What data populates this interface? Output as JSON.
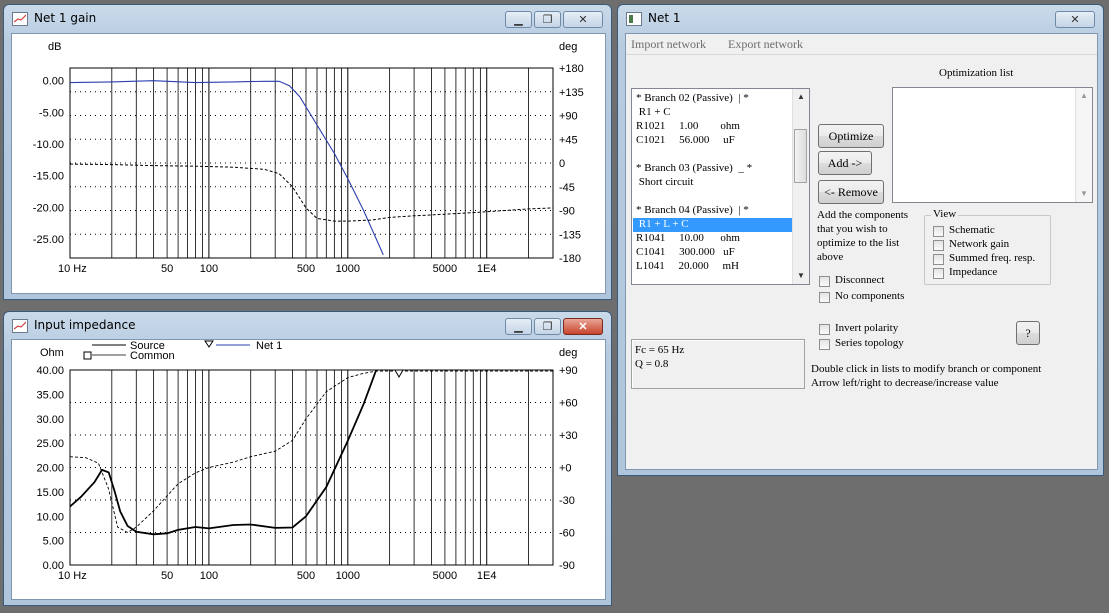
{
  "gain_window": {
    "title": "Net 1 gain",
    "y_left_unit": "dB",
    "y_right_unit": "deg",
    "y_left_ticks": [
      "0.00",
      "-5.00",
      "-10.00",
      "-15.00",
      "-20.00",
      "-25.00"
    ],
    "y_right_ticks": [
      "+180",
      "+135",
      "+90",
      "+45",
      "0",
      "-45",
      "-90",
      "-135",
      "-180"
    ],
    "x_ticks": [
      "10 Hz",
      "50",
      "100",
      "500",
      "1000",
      "5000",
      "1E4"
    ]
  },
  "impedance_window": {
    "title": "Input impedance",
    "y_left_unit": "Ohm",
    "y_right_unit": "deg",
    "legend": {
      "source": "Source",
      "common": "Common",
      "net": "Net 1"
    },
    "y_left_ticks": [
      "40.00",
      "35.00",
      "30.00",
      "25.00",
      "20.00",
      "15.00",
      "10.00",
      "5.00",
      "0.00"
    ],
    "y_right_ticks": [
      "+90",
      "+60",
      "+30",
      "+0",
      "-30",
      "-60",
      "-90"
    ],
    "x_ticks": [
      "10 Hz",
      "50",
      "100",
      "500",
      "1000",
      "5000",
      "1E4"
    ]
  },
  "net_window": {
    "title": "Net 1",
    "menu": [
      "Import network",
      "Export network"
    ],
    "branch_list": [
      "* Branch 02 (Passive)  | *",
      " R1 + C",
      "R1021     1.00        ohm",
      "C1021     56.000     uF",
      "",
      "* Branch 03 (Passive)  _ *",
      " Short circuit",
      "",
      "* Branch 04 (Passive)  | *",
      " R1 + L + C",
      "R1041     10.00      ohm",
      "C1041     300.000   uF",
      "L1041     20.000     mH"
    ],
    "selected_index": 9,
    "optimization_label": "Optimization list",
    "buttons": {
      "optimize": "Optimize",
      "add": "Add ->",
      "remove": "<- Remove",
      "help": "?"
    },
    "add_hint": [
      "Add the components",
      "that you wish to",
      "optimize to the list",
      "above"
    ],
    "checkboxes": [
      "Disconnect",
      "No components",
      "Invert polarity",
      "Series topology"
    ],
    "view_group": {
      "label": "View",
      "items": [
        "Schematic",
        "Network gain",
        "Summed freq. resp.",
        "Impedance"
      ]
    },
    "fc_text": "Fc = 65 Hz",
    "q_text": "Q = 0.8",
    "hints": [
      "Double click in lists to modify branch or component",
      "Arrow left/right to decrease/increase value"
    ]
  },
  "chart_data": [
    {
      "type": "line",
      "title": "Net 1 gain",
      "xlabel": "",
      "ylabel": "dB",
      "y2label": "deg",
      "xscale": "log",
      "xlim": [
        10,
        30000
      ],
      "ylim": [
        -28,
        2
      ],
      "y2lim": [
        -180,
        180
      ],
      "series": [
        {
          "name": "",
          "axis": "left",
          "x": [
            10,
            20,
            40,
            80,
            150,
            250,
            320,
            380,
            450,
            600,
            800,
            1000,
            1300,
            1800
          ],
          "y": [
            -0.3,
            -0.2,
            0.0,
            -0.3,
            -0.2,
            -0.1,
            -0.1,
            -0.8,
            -2.5,
            -7.0,
            -11.5,
            -15.5,
            -20.5,
            -27.5
          ]
        },
        {
          "name": "",
          "axis": "right",
          "x": [
            10,
            20,
            40,
            80,
            150,
            250,
            320,
            400,
            500,
            600,
            800,
            1000,
            1500,
            2000,
            3000,
            5000,
            8000,
            12000,
            20000,
            30000
          ],
          "y": [
            -2,
            -3,
            -5,
            -6,
            -8,
            -12,
            -20,
            -45,
            -85,
            -105,
            -110,
            -110,
            -108,
            -103,
            -100,
            -97,
            -94,
            -91,
            -87,
            -85
          ]
        }
      ]
    },
    {
      "type": "line",
      "title": "Input impedance",
      "xlabel": "",
      "ylabel": "Ohm",
      "y2label": "deg",
      "xscale": "log",
      "xlim": [
        10,
        30000
      ],
      "ylim": [
        0,
        40
      ],
      "y2lim": [
        -90,
        90
      ],
      "series": [
        {
          "name": "Net 1",
          "axis": "left",
          "x": [
            10,
            12,
            15,
            17,
            19,
            21,
            23,
            26,
            30,
            40,
            50,
            60,
            80,
            100,
            150,
            200,
            300,
            400,
            500,
            700,
            1000,
            1300,
            1600
          ],
          "y": [
            12,
            14,
            17,
            19.5,
            19,
            15,
            11,
            8,
            6.8,
            6.3,
            6.5,
            7.2,
            7.8,
            7.5,
            8.2,
            8.3,
            7.6,
            7.7,
            10,
            16,
            25.5,
            33,
            40
          ]
        },
        {
          "name": "Common",
          "axis": "right",
          "x": [
            10,
            13,
            16,
            19,
            22,
            26,
            30,
            40,
            60,
            80,
            100,
            150,
            200,
            300,
            400,
            500,
            700,
            1000,
            1300,
            1600,
            3000,
            10000,
            30000
          ],
          "y": [
            10,
            9,
            4,
            -20,
            -55,
            -60,
            -55,
            -40,
            -15,
            -5,
            0,
            5,
            10,
            15,
            25,
            45,
            70,
            83,
            87,
            89,
            89,
            89,
            89
          ]
        }
      ]
    }
  ]
}
